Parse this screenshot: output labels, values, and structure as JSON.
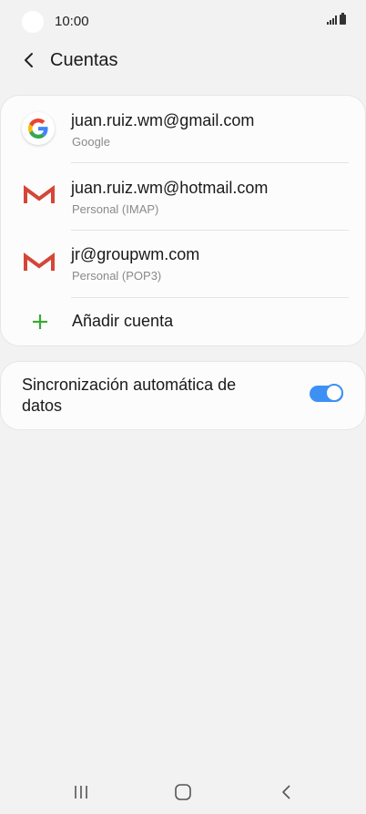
{
  "status_bar": {
    "time": "10:00",
    "icons": [
      "signal-icon",
      "battery-icon"
    ]
  },
  "header": {
    "back_icon": "back-arrow-icon",
    "title": "Cuentas"
  },
  "accounts": [
    {
      "name": "juan.ruiz.wm@gmail.com",
      "type": "Google",
      "icon": "google-icon"
    },
    {
      "name": "juan.ruiz.wm@hotmail.com",
      "type": "Personal (IMAP)",
      "icon": "email-icon"
    },
    {
      "name": "jr@groupwm.com",
      "type": "Personal (POP3)",
      "icon": "email-icon"
    }
  ],
  "add_account": {
    "label": "Añadir cuenta",
    "icon": "plus-icon"
  },
  "sync": {
    "label": "Sincronización automática de datos",
    "enabled": true
  },
  "nav_bar": {
    "icons": [
      "recent-apps-icon",
      "home-icon",
      "back-icon"
    ]
  },
  "colors": {
    "background": "#f2f2f2",
    "card": "#fcfcfc",
    "accent": "#3e91f4",
    "add_green": "#3aa935",
    "gmail_red": "#d44638",
    "secondary_text": "#8a8a8a"
  }
}
